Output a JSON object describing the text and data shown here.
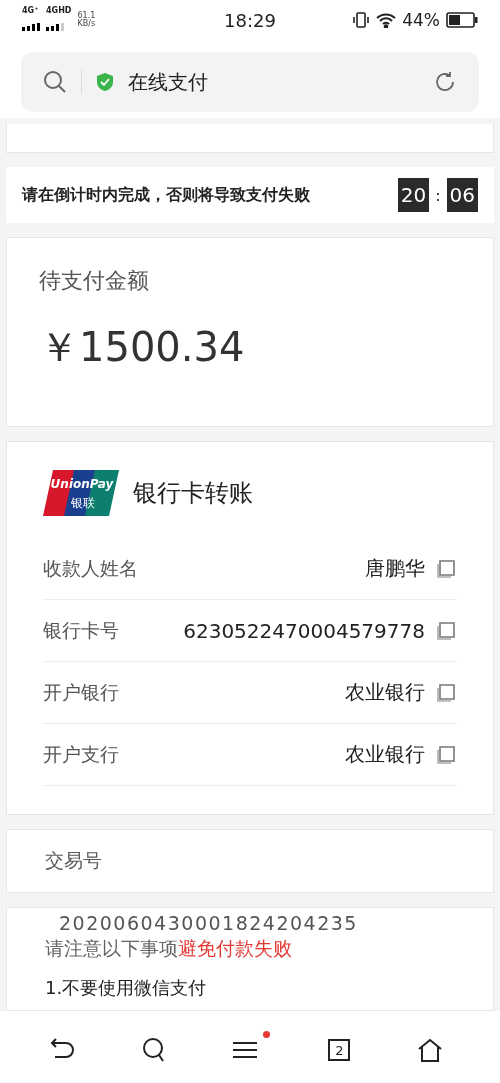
{
  "status_bar": {
    "network_1": "4G⁺",
    "network_2": "4GHD",
    "speed": "61.1",
    "speed_unit": "KB/s",
    "time": "18:29",
    "battery": "44%"
  },
  "address_bar": {
    "title": "在线支付",
    "secure": true
  },
  "countdown": {
    "message": "请在倒计时内完成，否则将导致支付失败",
    "minutes": "20",
    "separator": ":",
    "seconds": "06"
  },
  "amount": {
    "label": "待支付金额",
    "value": "￥1500.34"
  },
  "bank_transfer": {
    "logo_text": "UnionPay",
    "logo_subtext": "银联",
    "title": "银行卡转账",
    "fields": [
      {
        "label": "收款人姓名",
        "value": "唐鹏华"
      },
      {
        "label": "银行卡号",
        "value": "6230522470004579778"
      },
      {
        "label": "开户银行",
        "value": "农业银行"
      },
      {
        "label": "开户支行",
        "value": "农业银行"
      }
    ]
  },
  "transaction": {
    "label": "交易号",
    "value": "2020060430001824204235"
  },
  "notes": {
    "title": "请注意以下事项",
    "title_highlight": "避免付款失败",
    "items": [
      "1.不要使用微信支付"
    ]
  },
  "bottom_nav": [
    {
      "kind": "back",
      "dot": false
    },
    {
      "kind": "search",
      "dot": false
    },
    {
      "kind": "menu",
      "dot": true
    },
    {
      "kind": "tabs",
      "count": "2",
      "dot": false
    },
    {
      "kind": "home",
      "dot": false
    }
  ]
}
